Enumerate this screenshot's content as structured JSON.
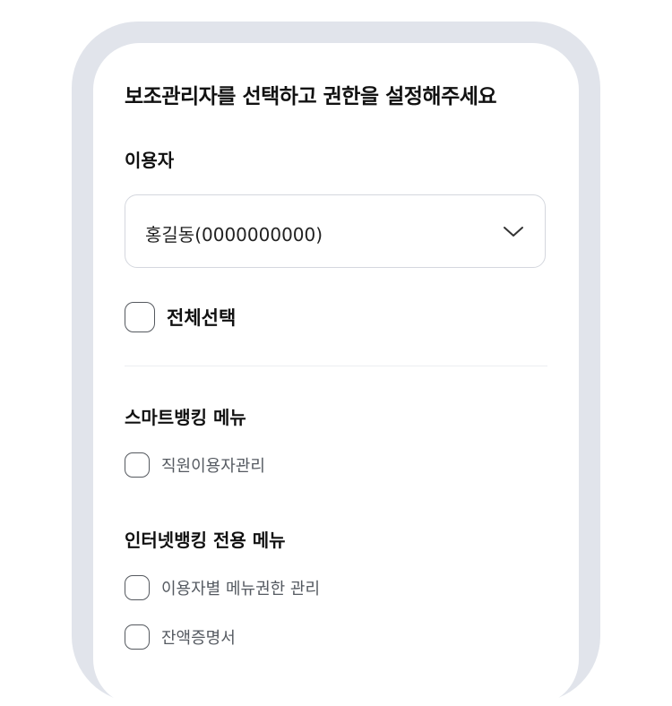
{
  "page": {
    "title": "보조관리자를 선택하고 권한을 설정해주세요"
  },
  "user_field": {
    "label": "이용자",
    "selected_value": "홍길동(0000000000)",
    "chevron_icon": "chevron-down-icon"
  },
  "select_all": {
    "label": "전체선택",
    "checked": false
  },
  "sections": [
    {
      "title": "스마트뱅킹 메뉴",
      "items": [
        {
          "label": "직원이용자관리",
          "checked": false
        }
      ]
    },
    {
      "title": "인터넷뱅킹 전용 메뉴",
      "items": [
        {
          "label": "이용자별 메뉴권한 관리",
          "checked": false
        },
        {
          "label": "잔액증명서",
          "checked": false
        }
      ]
    }
  ],
  "colors": {
    "frame": "#e1e4eb",
    "border": "#d4d7de",
    "checkbox_border": "#55595f",
    "text_primary": "#111111",
    "text_secondary": "#555a61"
  }
}
